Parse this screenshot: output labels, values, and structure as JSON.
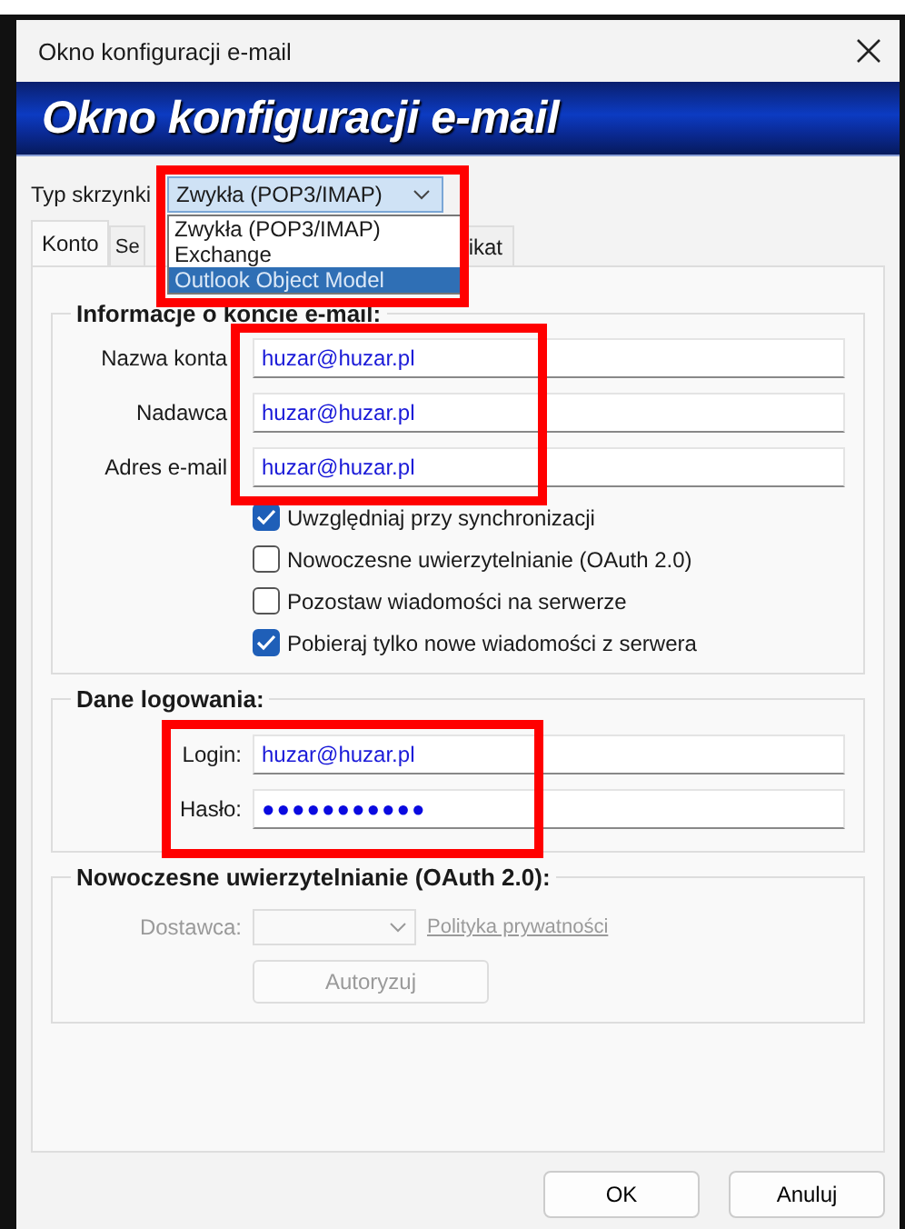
{
  "window": {
    "title": "Okno konfiguracji e-mail"
  },
  "banner": {
    "title": "Okno konfiguracji e-mail"
  },
  "mailbox_type": {
    "label": "Typ skrzynki",
    "value": "Zwykła (POP3/IMAP)",
    "expanded": true,
    "options": [
      {
        "label": "Zwykła (POP3/IMAP)",
        "highlighted": false
      },
      {
        "label": "Exchange",
        "highlighted": false
      },
      {
        "label": "Outlook Object Model",
        "highlighted": true
      }
    ]
  },
  "tabs": [
    {
      "label": "Konto",
      "selected": true
    },
    {
      "label": "Se",
      "selected": false
    },
    {
      "label": "ikat",
      "selected": false
    }
  ],
  "account_info": {
    "title": "Informacje o koncie e-mail:",
    "fields": [
      {
        "label": "Nazwa konta",
        "value": "huzar@huzar.pl"
      },
      {
        "label": "Nadawca",
        "value": "huzar@huzar.pl"
      },
      {
        "label": "Adres e-mail",
        "value": "huzar@huzar.pl"
      }
    ],
    "checkboxes": [
      {
        "label": "Uwzględniaj przy synchronizacji",
        "checked": true
      },
      {
        "label": "Nowoczesne uwierzytelnianie (OAuth 2.0)",
        "checked": false
      },
      {
        "label": "Pozostaw wiadomości na serwerze",
        "checked": false
      },
      {
        "label": "Pobieraj tylko nowe wiadomości z serwera",
        "checked": true
      }
    ]
  },
  "login": {
    "title": "Dane logowania:",
    "fields": [
      {
        "label": "Login:",
        "value": "huzar@huzar.pl",
        "kind": "text"
      },
      {
        "label": "Hasło:",
        "value": "●●●●●●●●●●●",
        "kind": "password"
      }
    ]
  },
  "oauth": {
    "title": "Nowoczesne uwierzytelnianie (OAuth 2.0):",
    "disabled": true,
    "provider_label": "Dostawca:",
    "privacy_link": "Polityka prywatności",
    "authorize_button": "Autoryzuj"
  },
  "buttons": [
    "OK",
    "Anuluj"
  ]
}
